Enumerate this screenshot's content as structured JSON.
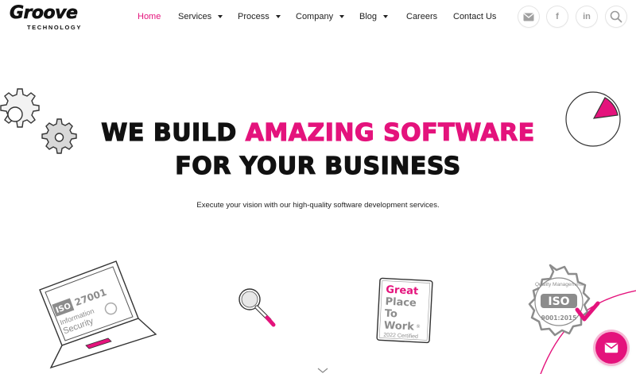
{
  "brand": {
    "name": "Groove",
    "tagline": "TECHNOLOGY"
  },
  "nav": {
    "items": [
      {
        "label": "Home",
        "active": true,
        "dropdown": false
      },
      {
        "label": "Services",
        "active": false,
        "dropdown": true
      },
      {
        "label": "Process",
        "active": false,
        "dropdown": true
      },
      {
        "label": "Company",
        "active": false,
        "dropdown": true
      },
      {
        "label": "Blog",
        "active": false,
        "dropdown": true
      },
      {
        "label": "Careers",
        "active": false,
        "dropdown": false
      },
      {
        "label": "Contact Us",
        "active": false,
        "dropdown": false
      }
    ],
    "social": [
      {
        "icon": "email-icon",
        "glyph": "✉"
      },
      {
        "icon": "facebook-icon",
        "glyph": "f"
      },
      {
        "icon": "linkedin-icon",
        "glyph": "in"
      }
    ],
    "search_icon": "search-icon"
  },
  "hero": {
    "line1_part1": "WE BUILD ",
    "line1_highlight": "AMAZING SOFTWARE",
    "line2": "FOR YOUR BUSINESS",
    "subtitle": "Execute your vision with our high-quality software development services."
  },
  "badges": {
    "iso27001": {
      "number": "27001",
      "logo": "ISO",
      "line1": "Information",
      "line2": "Security"
    },
    "gptw": {
      "line1": "Great",
      "line2": "Place",
      "line3": "To",
      "line4": "Work",
      "reg": "®",
      "certified": "2022 Certified"
    },
    "iso9001": {
      "top": "Quality Management",
      "logo": "ISO",
      "number": "9001:2015"
    }
  },
  "colors": {
    "accent": "#e4137c",
    "accent_light": "#f6b7d4",
    "text": "#111111",
    "badge_grey": "#8c8c8c"
  },
  "fab": {
    "icon": "email-icon"
  }
}
